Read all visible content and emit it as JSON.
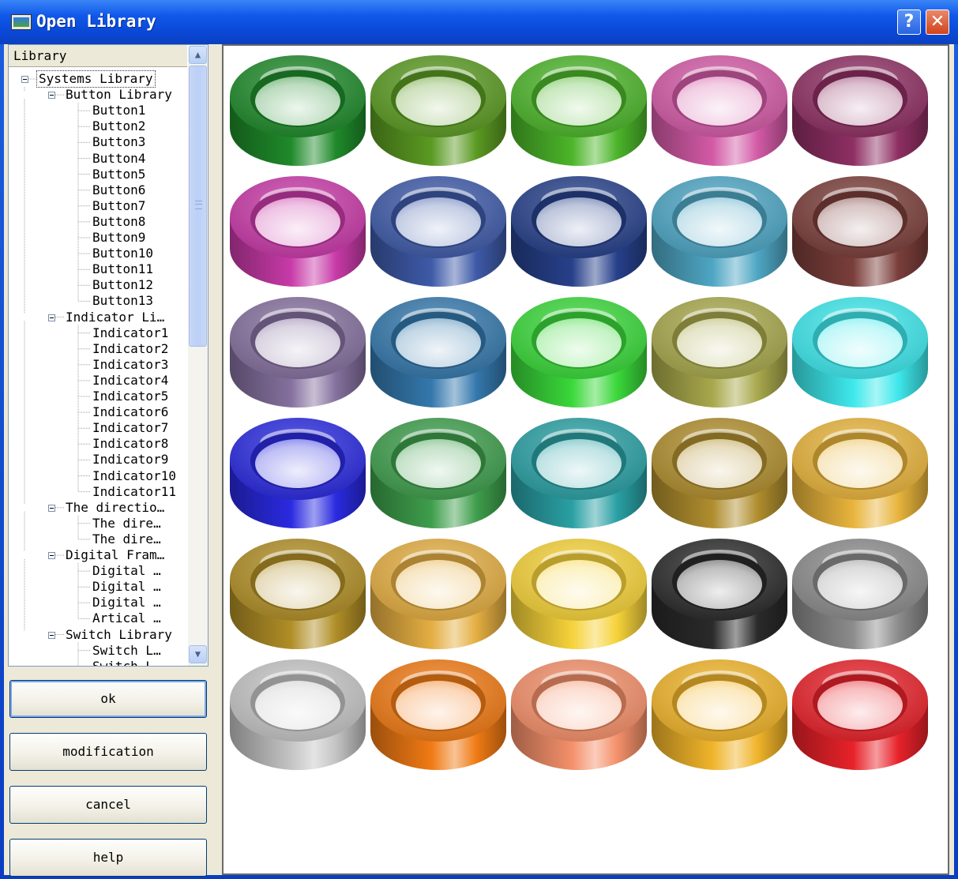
{
  "window": {
    "title": "Open Library"
  },
  "titlebar_buttons": {
    "help": "?",
    "close": "✕"
  },
  "tree": {
    "header": "Library",
    "nodes": [
      {
        "label": "Systems Library",
        "level": 0,
        "expander": true,
        "selected": true
      },
      {
        "label": "Button Library",
        "level": 1,
        "expander": true
      },
      {
        "label": "Button1",
        "level": 2
      },
      {
        "label": "Button2",
        "level": 2
      },
      {
        "label": "Button3",
        "level": 2
      },
      {
        "label": "Button4",
        "level": 2
      },
      {
        "label": "Button5",
        "level": 2
      },
      {
        "label": "Button6",
        "level": 2
      },
      {
        "label": "Button7",
        "level": 2
      },
      {
        "label": "Button8",
        "level": 2
      },
      {
        "label": "Button9",
        "level": 2
      },
      {
        "label": "Button10",
        "level": 2
      },
      {
        "label": "Button11",
        "level": 2
      },
      {
        "label": "Button12",
        "level": 2
      },
      {
        "label": "Button13",
        "level": 2
      },
      {
        "label": "Indicator Li…",
        "level": 1,
        "expander": true
      },
      {
        "label": "Indicator1",
        "level": 2
      },
      {
        "label": "Indicator2",
        "level": 2
      },
      {
        "label": "Indicator3",
        "level": 2
      },
      {
        "label": "Indicator4",
        "level": 2
      },
      {
        "label": "Indicator5",
        "level": 2
      },
      {
        "label": "Indicator6",
        "level": 2
      },
      {
        "label": "Indicator7",
        "level": 2
      },
      {
        "label": "Indicator8",
        "level": 2
      },
      {
        "label": "Indicator9",
        "level": 2
      },
      {
        "label": "Indicator10",
        "level": 2
      },
      {
        "label": "Indicator11",
        "level": 2
      },
      {
        "label": "The directio…",
        "level": 1,
        "expander": true
      },
      {
        "label": "The dire…",
        "level": 2
      },
      {
        "label": "The dire…",
        "level": 2
      },
      {
        "label": "Digital Fram…",
        "level": 1,
        "expander": true
      },
      {
        "label": "Digital …",
        "level": 2
      },
      {
        "label": "Digital …",
        "level": 2
      },
      {
        "label": "Digital …",
        "level": 2
      },
      {
        "label": "Artical …",
        "level": 2
      },
      {
        "label": "Switch Library",
        "level": 1,
        "expander": true
      },
      {
        "label": "Switch L…",
        "level": 2
      },
      {
        "label": "Switch L…",
        "level": 2
      }
    ]
  },
  "buttons": {
    "ok": "ok",
    "modification": "modification",
    "cancel": "cancel",
    "help": "help"
  },
  "gallery": {
    "button_colors": [
      "#1f8a2a",
      "#5a9a22",
      "#4cb52a",
      "#d35aa6",
      "#8e2f63",
      "#c83aa8",
      "#3e5aa8",
      "#26408a",
      "#4ea6c4",
      "#7a3e3a",
      "#85709e",
      "#3478ac",
      "#3ad83a",
      "#a8a84c",
      "#3ee8ec",
      "#2a2ae0",
      "#3e9e4c",
      "#2aa0a4",
      "#b08e2e",
      "#e8b43c",
      "#b08e26",
      "#e4ae42",
      "#f6d23a",
      "#2a2a2a",
      "#8c8c8c",
      "#c4c4c4",
      "#f07a14",
      "#f4906a",
      "#f0b42a",
      "#e8222a"
    ]
  }
}
